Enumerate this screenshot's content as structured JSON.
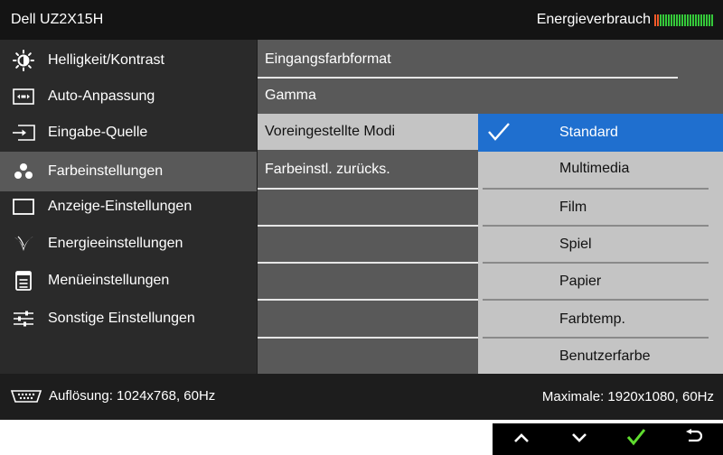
{
  "header": {
    "model": "Dell UZ2X15H",
    "energy_label": "Energieverbrauch",
    "energy_level": 0.09,
    "energy_bar_count": 22,
    "colors": {
      "energy_active": "#f25a2a",
      "energy_inactive": "#35c93a"
    }
  },
  "sidebar": {
    "items": [
      {
        "label": "Helligkeit/Kontrast",
        "icon": "brightness-icon"
      },
      {
        "label": "Auto-Anpassung",
        "icon": "auto-adjust-icon"
      },
      {
        "label": "Eingabe-Quelle",
        "icon": "input-source-icon"
      },
      {
        "label": "Farbeinstellungen",
        "icon": "color-icon",
        "selected": true
      },
      {
        "label": "Anzeige-Einstellungen",
        "icon": "display-icon"
      },
      {
        "label": "Energieeinstellungen",
        "icon": "energy-icon"
      },
      {
        "label": "Menüeinstellungen",
        "icon": "menu-icon"
      },
      {
        "label": "Sonstige Einstellungen",
        "icon": "sliders-icon"
      }
    ]
  },
  "submenu": {
    "items": [
      {
        "label": "Eingangsfarbformat"
      },
      {
        "label": "Gamma"
      },
      {
        "label": "Voreingestellte Modi",
        "selected": true
      },
      {
        "label": "Farbeinstl. zurücks."
      }
    ]
  },
  "options": {
    "items": [
      {
        "label": "Standard",
        "selected": true
      },
      {
        "label": "Multimedia"
      },
      {
        "label": "Film"
      },
      {
        "label": "Spiel"
      },
      {
        "label": "Papier"
      },
      {
        "label": "Farbtemp."
      },
      {
        "label": "Benutzerfarbe"
      }
    ]
  },
  "footer": {
    "resolution": "Auflösung: 1024x768, 60Hz",
    "max_resolution": "Maximale: 1920x1080, 60Hz"
  },
  "keys": [
    {
      "icon": "up-icon"
    },
    {
      "icon": "down-icon"
    },
    {
      "icon": "check-icon"
    },
    {
      "icon": "back-icon"
    }
  ],
  "colors": {
    "osd_background": "#1d1d1d",
    "selection_blue": "#1f6fcf",
    "options_background": "#c4c4c4",
    "submenu_background": "#595959",
    "confirm_green": "#5fdc2f"
  }
}
